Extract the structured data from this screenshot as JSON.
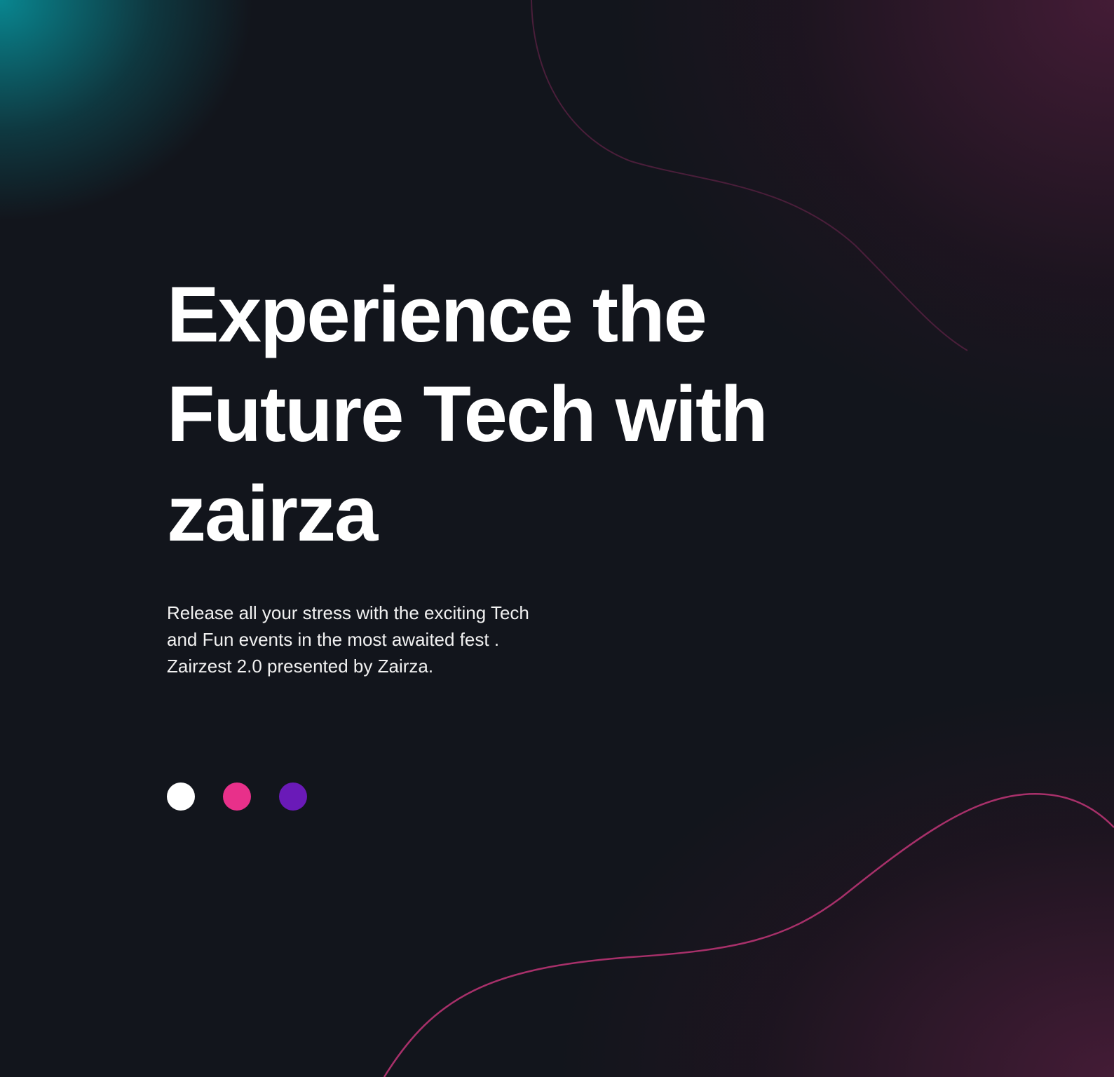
{
  "hero": {
    "headline_lines": [
      "Experience the",
      "Future Tech with",
      "zairza"
    ],
    "description": "Release all your stress with the exciting Tech and Fun events in the most awaited fest . Zairzest 2.0 presented by Zairza."
  },
  "carousel_dots": [
    {
      "color": "#ffffff",
      "active": true
    },
    {
      "color": "#e8308a",
      "active": false
    },
    {
      "color": "#6a1ab8",
      "active": false
    }
  ],
  "colors": {
    "background": "#12151c",
    "accent_line": "#b0306e",
    "teal_glow": "#088c96"
  }
}
